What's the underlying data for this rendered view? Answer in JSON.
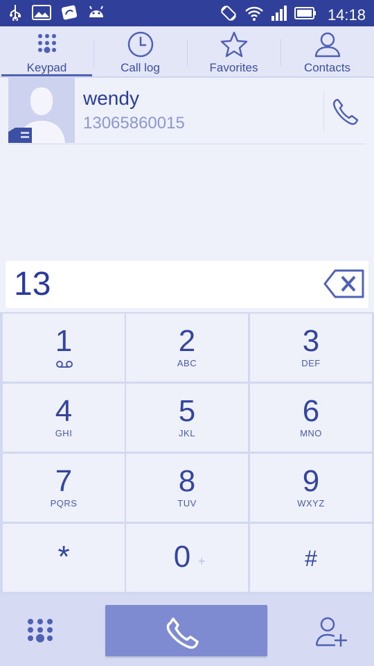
{
  "status_bar": {
    "time": "14:18",
    "left_icons": [
      "usb-icon",
      "image-icon",
      "app-icon",
      "android-icon"
    ],
    "right_icons": [
      "rotation-icon",
      "wifi-icon",
      "signal-icon",
      "battery-icon"
    ]
  },
  "tabs": [
    {
      "label": "Keypad",
      "icon": "keypad-icon",
      "active": true
    },
    {
      "label": "Call log",
      "icon": "clock-icon",
      "active": false
    },
    {
      "label": "Favorites",
      "icon": "star-icon",
      "active": false
    },
    {
      "label": "Contacts",
      "icon": "person-icon",
      "active": false
    }
  ],
  "suggestion": {
    "name": "wendy",
    "number": "13065860015"
  },
  "dial_input": {
    "value": "13"
  },
  "keypad": {
    "keys": [
      {
        "digit": "1",
        "letters": ""
      },
      {
        "digit": "2",
        "letters": "ABC"
      },
      {
        "digit": "3",
        "letters": "DEF"
      },
      {
        "digit": "4",
        "letters": "GHI"
      },
      {
        "digit": "5",
        "letters": "JKL"
      },
      {
        "digit": "6",
        "letters": "MNO"
      },
      {
        "digit": "7",
        "letters": "PQRS"
      },
      {
        "digit": "8",
        "letters": "TUV"
      },
      {
        "digit": "9",
        "letters": "WXYZ"
      },
      {
        "digit": "*",
        "letters": ""
      },
      {
        "digit": "0",
        "letters": "+"
      },
      {
        "digit": "#",
        "letters": ""
      }
    ]
  },
  "colors": {
    "status_bar": "#2f3f9a",
    "accent": "#3b4ea2",
    "call_button": "#7e8bd0",
    "background": "#eef0fa"
  }
}
